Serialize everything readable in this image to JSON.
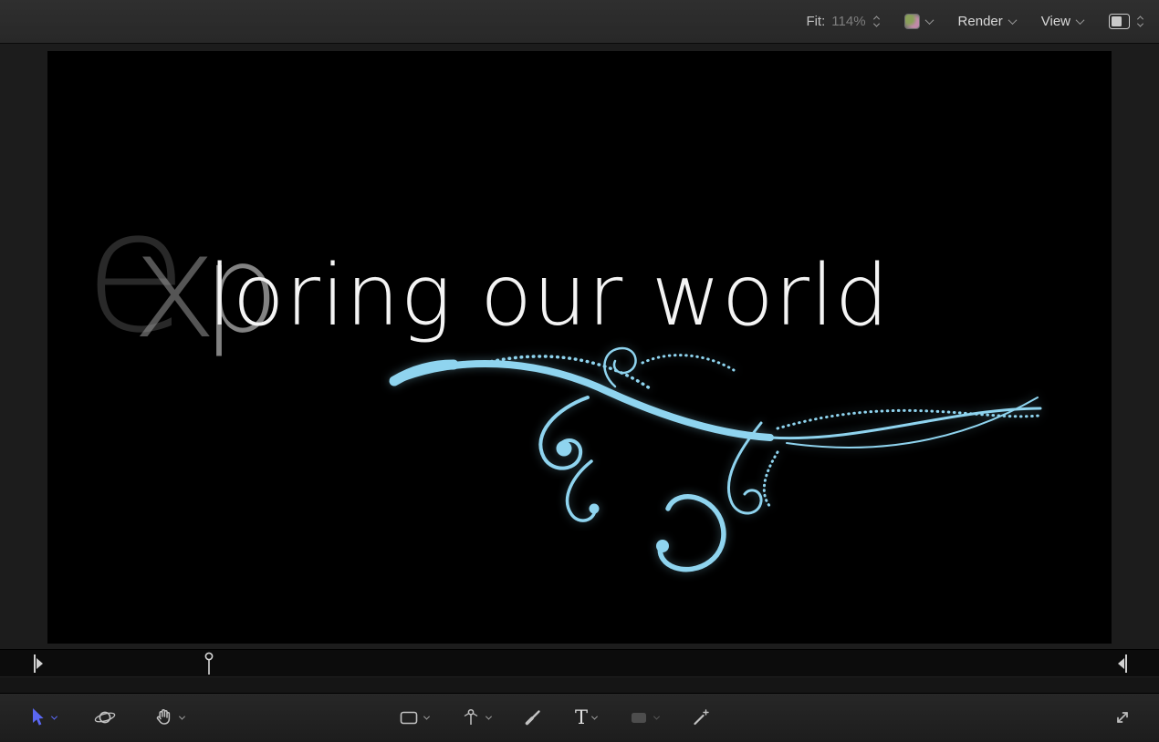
{
  "topbar": {
    "fit_label": "Fit:",
    "zoom_value": "114%",
    "render_label": "Render",
    "view_label": "View"
  },
  "canvas": {
    "full_title": "exploring our world",
    "title_ghost_1": "e",
    "title_ghost_2": "x",
    "title_ghost_3": "p",
    "title_main": "loring our world"
  },
  "colors": {
    "flourish": "#8fd4ef",
    "accent_blue": "#5a67f2",
    "canvas_background": "#000000"
  },
  "tools": {
    "text_tool_glyph": "T",
    "items": [
      {
        "name": "select-transform",
        "state": "active"
      },
      {
        "name": "3d-transform",
        "state": "normal"
      },
      {
        "name": "pan",
        "state": "normal"
      },
      {
        "name": "rectangle",
        "state": "normal"
      },
      {
        "name": "bezier",
        "state": "normal"
      },
      {
        "name": "paint-stroke",
        "state": "normal"
      },
      {
        "name": "text",
        "state": "normal"
      },
      {
        "name": "mask",
        "state": "disabled"
      },
      {
        "name": "adjust-item",
        "state": "normal"
      }
    ]
  },
  "timeline": {
    "playhead_position_pct": 18
  }
}
